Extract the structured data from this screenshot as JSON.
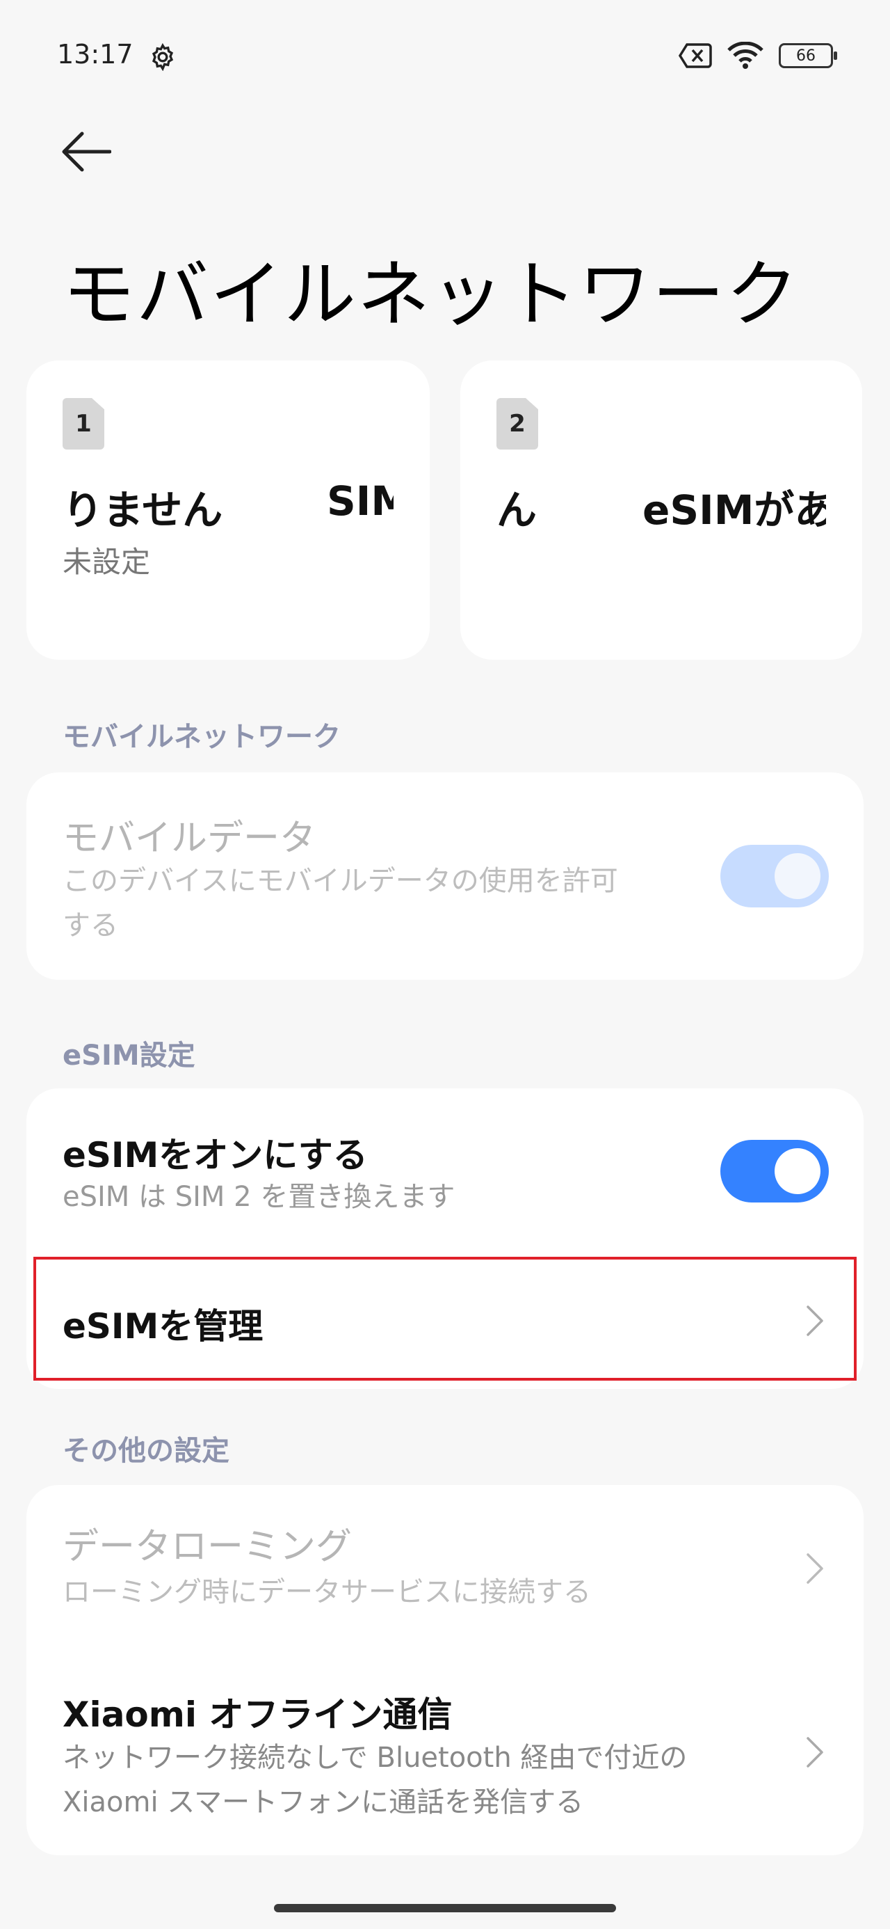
{
  "status_bar": {
    "time": "13:17",
    "battery": "66",
    "icons": [
      "gear-icon",
      "no-sim-icon",
      "wifi-icon",
      "battery-icon"
    ]
  },
  "header": {
    "back_icon": "back-arrow-icon",
    "title": "モバイルネットワーク"
  },
  "sim_cards": [
    {
      "slot": "1",
      "name_visible": "りません",
      "name_visible_2": "SIM",
      "status": "未設定"
    },
    {
      "slot": "2",
      "name_visible": "ん",
      "name_visible_2": "eSIMがあ",
      "status": ""
    }
  ],
  "sections": {
    "mobile_network": {
      "label": "モバイルネットワーク",
      "mobile_data": {
        "title": "モバイルデータ",
        "subtitle": "このデバイスにモバイルデータの使用を許可する",
        "subtitle_line1": "このデバイスにモバイルデータの使用を許可",
        "subtitle_line2": "する",
        "enabled": true,
        "disabled_state": true
      }
    },
    "esim": {
      "label": "eSIM設定",
      "esim_on": {
        "title": "eSIMをオンにする",
        "subtitle": "eSIM は SIM 2 を置き換えます",
        "enabled": true
      },
      "manage": {
        "title": "eSIMを管理"
      }
    },
    "other": {
      "label": "その他の設定",
      "roaming": {
        "title": "データローミング",
        "subtitle": "ローミング時にデータサービスに接続する"
      },
      "offline": {
        "title": "Xiaomi オフライン通信",
        "subtitle_line1": "ネットワーク接続なしで Bluetooth 経由で付近の",
        "subtitle_line2": "Xiaomi スマートフォンに通話を発信する"
      }
    }
  },
  "colors": {
    "accent": "#3482ff",
    "accent_disabled": "#c7dcff",
    "section_label": "#8d93ad",
    "highlight": "#e0202a"
  }
}
